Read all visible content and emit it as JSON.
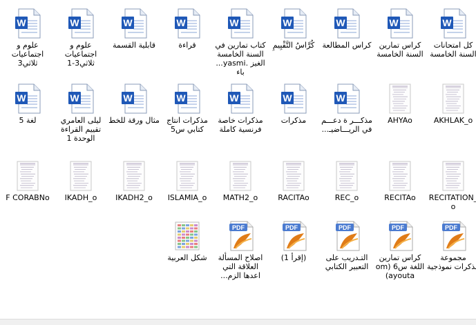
{
  "window": {
    "title": ""
  },
  "icons": {
    "word": "word-document-icon",
    "pdf": "pdf-document-icon",
    "scan": "scanned-image-icon",
    "sheet": "spreadsheet-image-icon"
  },
  "colors": {
    "word_blue": "#1f58b7",
    "pdf_orange": "#e07c18",
    "selection": "#cce8ff"
  },
  "files": [
    {
      "type": "word",
      "label": "كل امتحانات السنة الخامسة"
    },
    {
      "type": "word",
      "label": "كراس تمارين السنة الخامسة"
    },
    {
      "type": "word",
      "label": "كراس المطالعة"
    },
    {
      "type": "word",
      "label": "كُرَّاسُ التَّقْيِيمِ"
    },
    {
      "type": "word",
      "label": "كتاب تمارين في السنة الخامسة الغيز .yasmi... باء"
    },
    {
      "type": "word",
      "label": "قراءة"
    },
    {
      "type": "word",
      "label": "قابلية القسمة"
    },
    {
      "type": "word",
      "label": "علوم و اجتماعيات ثلاثي3-1"
    },
    {
      "type": "word",
      "label": "علوم و اجتماعيات ثلاثي3"
    },
    {
      "type": "scan",
      "label": "AKHLAK_o"
    },
    {
      "type": "scan",
      "label": "AHYAo"
    },
    {
      "type": "word",
      "label": "مذكـــر ة دعـــم في الريـــاضيـ..."
    },
    {
      "type": "word",
      "label": "مذكرات"
    },
    {
      "type": "word",
      "label": "مذكرات خاصة فرنسية كاملة"
    },
    {
      "type": "word",
      "label": "مذكرات انتاج كتابي س5"
    },
    {
      "type": "word",
      "label": "مثال ورقة للخط"
    },
    {
      "type": "word",
      "label": "ليلى العامري تقييم القراءة الوحدة 1"
    },
    {
      "type": "word",
      "label": "لغة 5"
    },
    {
      "type": "scan",
      "label": "RECITATION_o"
    },
    {
      "type": "scan",
      "label": "RECITAo"
    },
    {
      "type": "scan",
      "label": "REC_o"
    },
    {
      "type": "scan",
      "label": "RACITAo"
    },
    {
      "type": "scan",
      "label": "MATH2_o"
    },
    {
      "type": "scan",
      "label": "ISLAMIA_o"
    },
    {
      "type": "scan",
      "label": "IKADH2_o"
    },
    {
      "type": "scan",
      "label": "IKADH_o"
    },
    {
      "type": "scan",
      "label": "F CORABNo"
    },
    {
      "type": "pdf",
      "label": "مجموعة مذكرات نموذجية"
    },
    {
      "type": "pdf",
      "label": "كراس تمارين اللغة س6 (om ayouta)"
    },
    {
      "type": "pdf",
      "label": "التـدريب على التعبير الكتابي"
    },
    {
      "type": "pdf",
      "label": "(إقرأ 1)"
    },
    {
      "type": "pdf",
      "label": "اصلاح المسألة العلاقة التي اعدها الزم..."
    },
    {
      "type": "sheet",
      "label": "شكل العربية"
    }
  ]
}
